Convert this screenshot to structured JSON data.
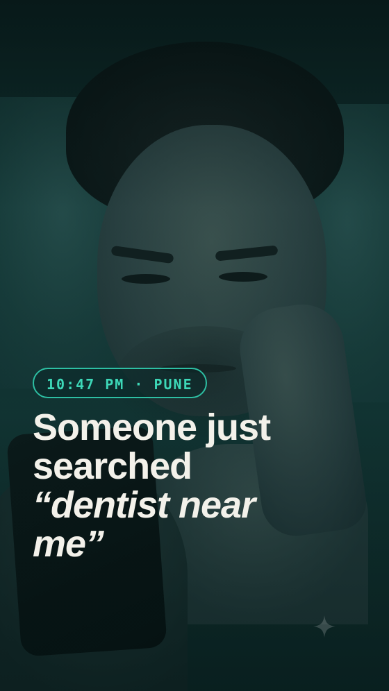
{
  "badge": {
    "text": "10:47 PM · PUNE",
    "color": "#3dd8b8"
  },
  "headline": {
    "line1": "Someone just",
    "line2": "searched",
    "line3": "“dentist near",
    "line4": "me”",
    "color": "#f3f1ea"
  },
  "decor": {
    "sparkle_icon": "sparkle-icon"
  }
}
